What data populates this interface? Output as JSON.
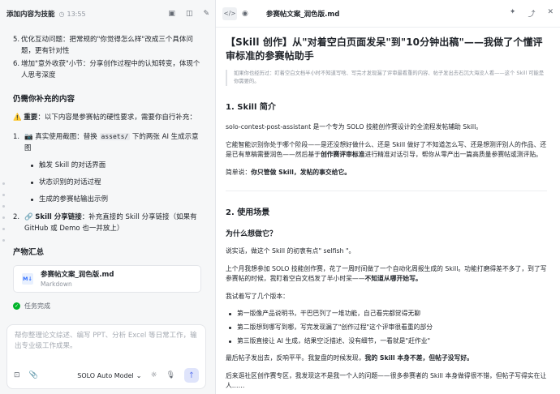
{
  "left": {
    "title": "添加内容为技能",
    "time": "13:55",
    "items": [
      {
        "num": "5.",
        "text": "优化互动问题：把常规的\"你觉得怎么样\"改成三个具体问题，更有针对性"
      },
      {
        "num": "6.",
        "text": "增加\"意外收获\"小节：分享创作过程中的认知转变，体现个人思考深度"
      }
    ],
    "section_todo": "仍需你补充的内容",
    "important_label": "重要",
    "important_text": "：以下内容是参赛帖的硬性要求，需要你自行补充：",
    "todo1_pre": "📷 真实使用截图：替换 ",
    "todo1_code": "assets/",
    "todo1_post": " 下的两张 AI 生成示意图",
    "subs": [
      "触发 Skill 的对话界面",
      "状态识别的对话过程",
      "生成的参赛帖输出示例"
    ],
    "todo2_label": "Skill 分享链接",
    "todo2_text": "：补充直接的 Skill 分享链接（如果有 GitHub 或 Demo 也一并放上）",
    "section_output": "产物汇总",
    "file_name": "参赛帖文案_润色版.md",
    "file_type": "Markdown",
    "md_badge": "M↓",
    "task_done": "任务完成",
    "composer_placeholder": "帮你整理论文综述、编写 PPT、分析 Excel 等日常工作，输出专业级工作成果。",
    "model": "SOLO Auto Model"
  },
  "right": {
    "code_toggle": "</>",
    "doc_title": "参赛帖文案_润色版.md",
    "h1": "【Skill 创作】从\"对着空白页面发呆\"到\"10分钟出稿\"——我做了个懂评审标准的参赛帖助手",
    "quote": "如果你也经历过：盯着空白文档半小时不知道写啥、写完才发现漏了评审最看重的内容、帖子发出去石沉大海没人看——这个 Skill 可能是你需要的。",
    "h2_intro": "1. Skill 简介",
    "intro_p1": "solo-contest-post-assistant 是一个专为 SOLO 技能创作赛设计的全流程发帖辅助 Skill。",
    "intro_p2_pre": "它能智能识别你处于哪个阶段——是还没想好做什么、还是 Skill 做好了不知道怎么写、还是想测评别人的作品、还是已有草稿需要润色——然后基于",
    "intro_p2_bold": "创作赛评审标准",
    "intro_p2_post": "进行精准对话引导，帮你从零产出一篇高质量参赛帖或测评贴。",
    "intro_p3_pre": "简单说：",
    "intro_p3_bold": "你只管做 Skill，发帖的事交给它。",
    "h2_scene": "2. 使用场景",
    "h3_why": "为什么想做它？",
    "why_p1": "说实话，做这个 Skill 的初衷有点\" selfish \"。",
    "why_p2_pre": "上个月我想参加 SOLO 技能创作赛，花了一周时间做了一个自动化周报生成的 Skill。功能打磨得差不多了，到了写参赛帖的时候，我盯着空白文档发了半小时呆——",
    "why_p2_bold": "不知道从哪开始写。",
    "why_p3": "我试着写了几个版本：",
    "bullets": [
      "第一版像产品说明书，干巴巴列了一堆功能，自己看完都觉得无聊",
      "第二版想到哪写到哪，写完发现漏了\"创作过程\"这个评审很看重的部分",
      "第三版直接让 AI 生成，结果空泛描述、没有细节，一看就是\"赶作业\""
    ],
    "why_p4_pre": "最后帖子发出去，反响平平。我复盘的时候发现，",
    "why_p4_bold": "我的 Skill 本身不差，但帖子没写好。",
    "why_p5": "后来逛社区创作赛专区，我发现这不是我一个人的问题——很多参赛者的 Skill 本身做得很不错，但帖子写得实在让人……"
  }
}
